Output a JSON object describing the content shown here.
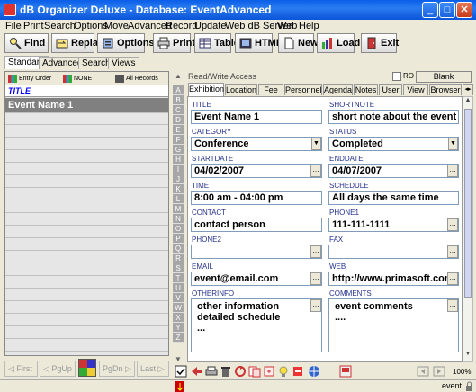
{
  "window": {
    "title": "dB Organizer Deluxe - Database: EventAdvanced"
  },
  "menu": [
    "File",
    "Print",
    "Search",
    "Options",
    "Move",
    "Advanced",
    "Record",
    "Update",
    "Web dB Server",
    "Web",
    "Help"
  ],
  "toolbar": {
    "find": "Find",
    "replace": "Replace",
    "options": "Options",
    "print": "Print",
    "table": "Table",
    "html": "HTML",
    "new": "New",
    "load": "Load",
    "exit": "Exit"
  },
  "left_tabs": [
    "Standard",
    "Advanced",
    "Search",
    "Views"
  ],
  "sort": {
    "entry_order": "Entry Order",
    "none": "NONE",
    "all_records": "All Records"
  },
  "list": {
    "header": "TITLE",
    "rows": [
      "Event Name 1"
    ]
  },
  "nav": {
    "first": "First",
    "pgup": "PgUp",
    "pgdn": "PgDn",
    "last": "Last"
  },
  "alpha_letters": [
    "A",
    "B",
    "C",
    "D",
    "E",
    "F",
    "G",
    "H",
    "I",
    "J",
    "K",
    "L",
    "M",
    "N",
    "O",
    "P",
    "Q",
    "R",
    "S",
    "T",
    "U",
    "V",
    "W",
    "X",
    "Y",
    "Z"
  ],
  "access": {
    "mode": "Read/Write Access",
    "ro_label": "RO",
    "blank_button": "Blank"
  },
  "form_tabs": [
    "Exhibition",
    "Location",
    "Fee",
    "Personnel",
    "Agenda",
    "Notes",
    "User",
    "View",
    "Browser"
  ],
  "fields": {
    "title": {
      "label": "TITLE",
      "value": "Event Name 1"
    },
    "shortnote": {
      "label": "SHORTNOTE",
      "value": "short note about the event"
    },
    "category": {
      "label": "CATEGORY",
      "value": "Conference"
    },
    "status": {
      "label": "STATUS",
      "value": "Completed"
    },
    "startdate": {
      "label": "STARTDATE",
      "value": "04/02/2007"
    },
    "enddate": {
      "label": "ENDDATE",
      "value": "04/07/2007"
    },
    "time": {
      "label": "TIME",
      "value": "8:00 am - 04:00 pm"
    },
    "schedule": {
      "label": "SCHEDULE",
      "value": "All days the same time"
    },
    "contact": {
      "label": "CONTACT",
      "value": "contact person"
    },
    "phone1": {
      "label": "PHONE1",
      "value": "111-111-1111"
    },
    "phone2": {
      "label": "PHONE2",
      "value": ""
    },
    "fax": {
      "label": "FAX",
      "value": ""
    },
    "email": {
      "label": "EMAIL",
      "value": "event@email.com"
    },
    "web": {
      "label": "WEB",
      "value": "http://www.primasoft.com"
    },
    "otherinfo": {
      "label": "OTHERINFO",
      "value": "other information\ndetailed schedule\n..."
    },
    "comments": {
      "label": "COMMENTS",
      "value": "event comments\n...."
    }
  },
  "zoom": "100%",
  "status": {
    "user": "event"
  },
  "colors": {
    "title_bar": "#0a5ee8",
    "list_selected": "#808080",
    "alpha_bar": "#a6a6a6",
    "label_text": "#24308a"
  }
}
